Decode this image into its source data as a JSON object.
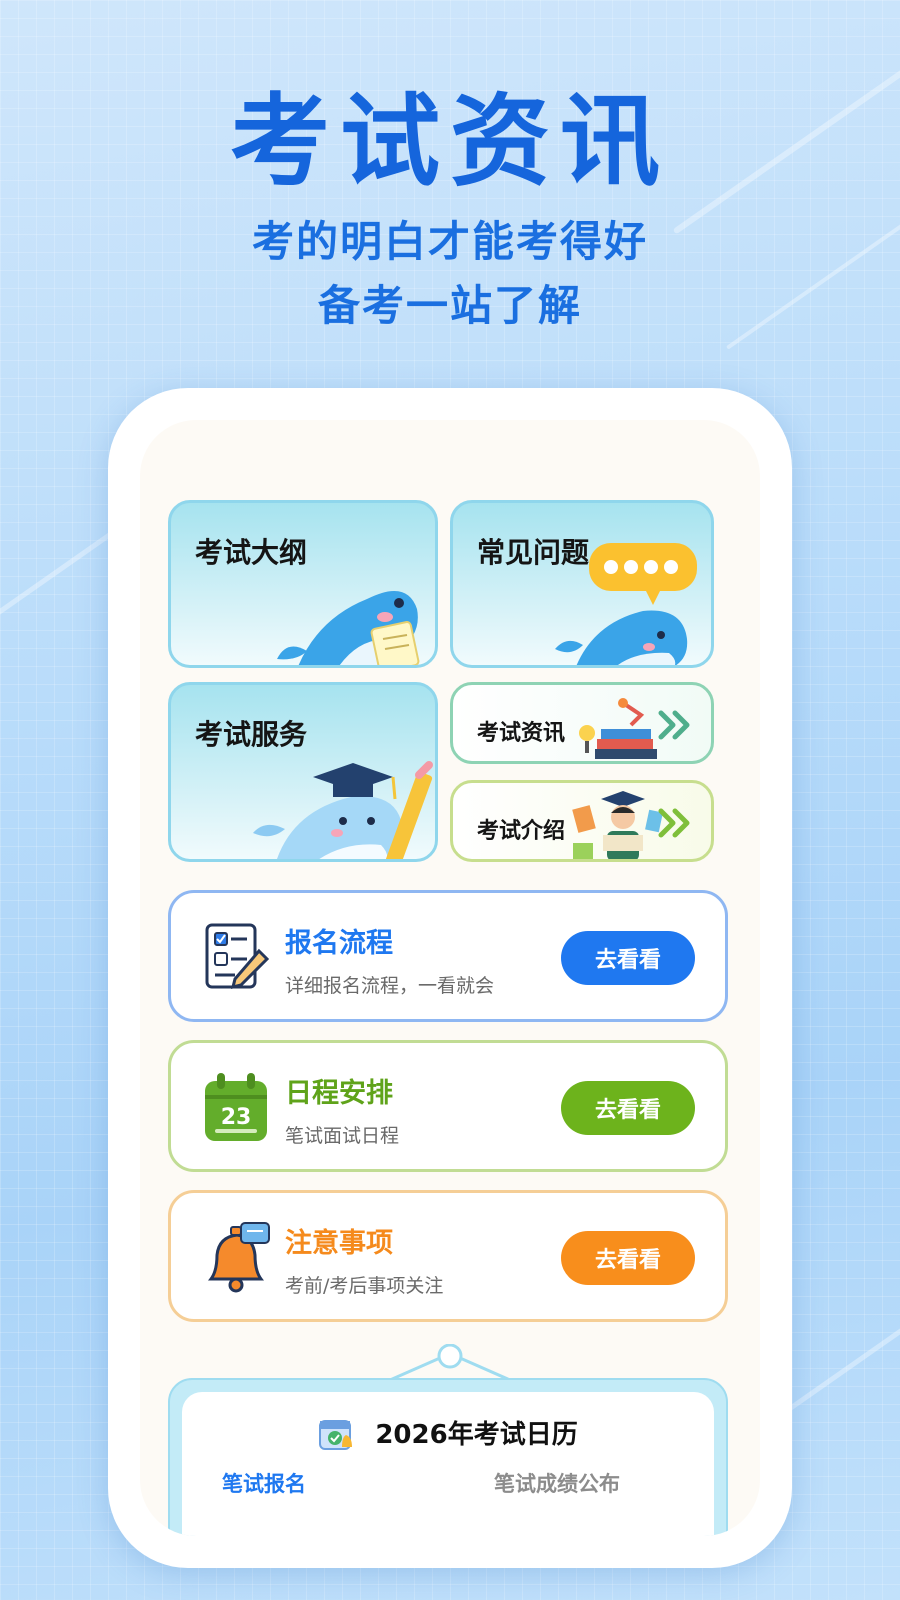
{
  "hero": {
    "title": "考试资讯",
    "subtitle_line1": "考的明白才能考得好",
    "subtitle_line2": "备考一站了解"
  },
  "grid": {
    "outline": {
      "title": "考试大纲",
      "icon": "whale-reading-icon"
    },
    "faq": {
      "title": "常见问题",
      "icon": "whale-chat-bubble-icon"
    },
    "service": {
      "title": "考试服务",
      "icon": "whale-graduate-icon"
    },
    "news": {
      "title": "考试资讯",
      "icon": "books-desk-icon"
    },
    "intro": {
      "title": "考试介绍",
      "icon": "student-reading-icon"
    }
  },
  "rows": [
    {
      "title": "报名流程",
      "desc": "详细报名流程，一看就会",
      "button": "去看看",
      "icon": "form-checklist-icon",
      "color": "#1f78f0"
    },
    {
      "title": "日程安排",
      "desc": "笔试面试日程",
      "button": "去看看",
      "icon": "calendar-icon",
      "day": "23",
      "color": "#6db31c"
    },
    {
      "title": "注意事项",
      "desc": "考前/考后事项关注",
      "button": "去看看",
      "icon": "bell-icon",
      "color": "#f88e1c"
    }
  ],
  "calendar": {
    "title": "2026年考试日历",
    "tab_active": "笔试报名",
    "tab_inactive": "笔试成绩公布"
  },
  "colors": {
    "title_blue": "#1565dc",
    "accent_blue": "#1f78f0",
    "accent_green": "#6db31c",
    "accent_orange": "#f88e1c"
  }
}
